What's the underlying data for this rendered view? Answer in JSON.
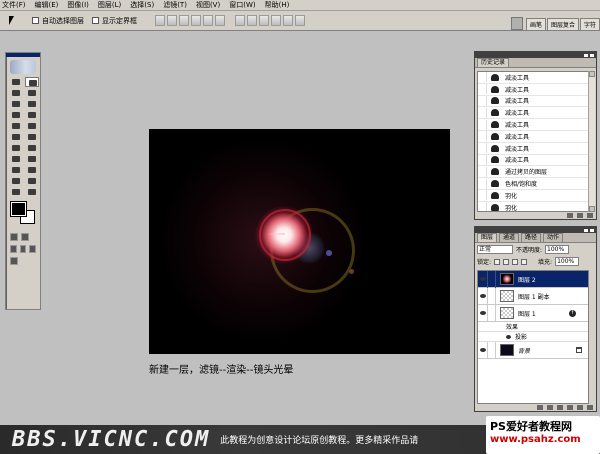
{
  "menu": [
    "文件(F)",
    "编辑(E)",
    "图像(I)",
    "图层(L)",
    "选择(S)",
    "滤镜(T)",
    "视图(V)",
    "窗口(W)",
    "帮助(H)"
  ],
  "options": {
    "auto_select_label": "自动选择图层",
    "show_bounds_label": "显示定界框"
  },
  "palette_well": {
    "tabs": [
      "画笔",
      "图层复合",
      "字符"
    ]
  },
  "caption": "新建一层，滤镜--渲染--镜头光晕",
  "history": {
    "tabs": [
      "历史记录"
    ],
    "items": [
      "减淡工具",
      "减淡工具",
      "减淡工具",
      "减淡工具",
      "减淡工具",
      "减淡工具",
      "减淡工具",
      "减淡工具",
      "通过拷贝的图层",
      "色相/饱和度",
      "羽化",
      "羽化"
    ]
  },
  "layers": {
    "tabs": [
      "图层",
      "通道",
      "路径",
      "动作"
    ],
    "blend_mode": "正常",
    "opacity_label": "不透明度:",
    "opacity_value": "100%",
    "lock_label": "锁定:",
    "fill_label": "填充:",
    "fill_value": "100%",
    "items": [
      {
        "name": "图层 2",
        "thumb": "flare",
        "active": true
      },
      {
        "name": "图层 1 副本",
        "thumb": "check",
        "active": false
      },
      {
        "name": "图层 1",
        "thumb": "check",
        "active": false
      }
    ],
    "effects_label": "效果",
    "shadow_label": "投影",
    "background_label": "背景"
  },
  "banner": {
    "logo": "BBS.VICNC.COM",
    "text": "此教程为创意设计论坛原创教程。更多精采作品请",
    "site_name": "PS爱好者教程网",
    "site_url": "www.psahz.com"
  }
}
